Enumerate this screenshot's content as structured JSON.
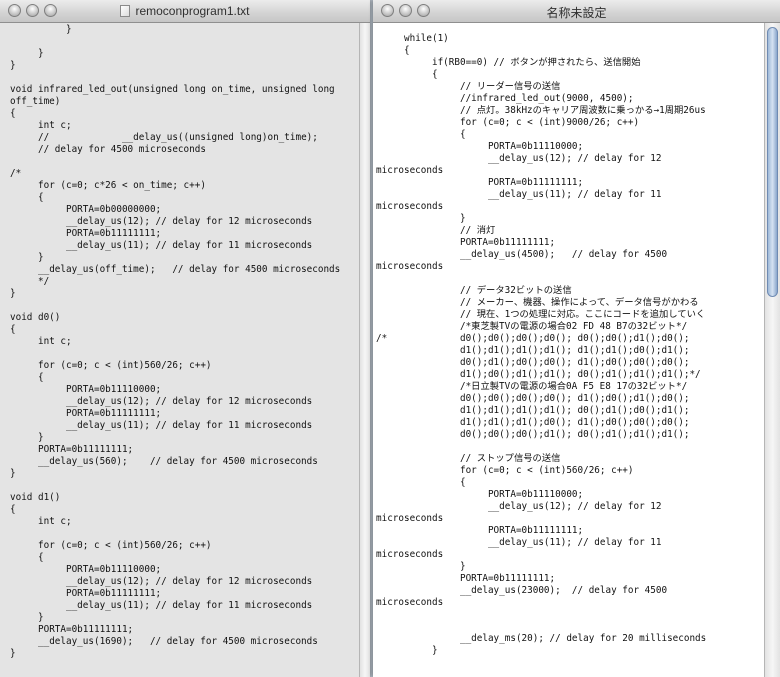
{
  "left_window": {
    "title": "remoconprogram1.txt",
    "code_lines": [
      "\t\t}",
      "",
      "\t}",
      "}",
      "",
      "void infrared_led_out(unsigned long on_time, unsigned long",
      "off_time)",
      "{",
      "\tint c;",
      "\t//\t\t\t__delay_us((unsigned long)on_time);",
      "\t// delay for 4500 microseconds",
      "",
      "/*",
      "\tfor (c=0; c*26 < on_time; c++)",
      "\t{",
      "\t\tPORTA=0b00000000;",
      "\t\t__delay_us(12); // delay for 12 microseconds",
      "\t\tPORTA=0b11111111;",
      "\t\t__delay_us(11); // delay for 11 microseconds",
      "\t}",
      "\t__delay_us(off_time);   // delay for 4500 microseconds",
      "\t*/",
      "}",
      "",
      "void d0()",
      "{",
      "\tint c;",
      "",
      "\tfor (c=0; c < (int)560/26; c++)",
      "\t{",
      "\t\tPORTA=0b11110000;",
      "\t\t__delay_us(12); // delay for 12 microseconds",
      "\t\tPORTA=0b11111111;",
      "\t\t__delay_us(11); // delay for 11 microseconds",
      "\t}",
      "\tPORTA=0b11111111;",
      "\t__delay_us(560);\t// delay for 4500 microseconds",
      "}",
      "",
      "void d1()",
      "{",
      "\tint c;",
      "",
      "\tfor (c=0; c < (int)560/26; c++)",
      "\t{",
      "\t\tPORTA=0b11110000;",
      "\t\t__delay_us(12); // delay for 12 microseconds",
      "\t\tPORTA=0b11111111;",
      "\t\t__delay_us(11); // delay for 11 microseconds",
      "\t}",
      "\tPORTA=0b11111111;",
      "\t__delay_us(1690);\t// delay for 4500 microseconds",
      "}"
    ]
  },
  "right_window": {
    "title": "名称未設定",
    "code_lines": [
      "\twhile(1)",
      "\t{",
      "\t\tif(RB0==0) // ボタンが押されたら、送信開始",
      "\t\t{",
      "\t\t\t// リーダー信号の送信",
      "\t\t\t//infrared_led_out(9000, 4500);",
      "\t\t\t// 点灯。38kHzのキャリア周波数に乗っかる→1周期26us",
      "\t\t\tfor (c=0; c < (int)9000/26; c++)",
      "\t\t\t{",
      "\t\t\t\tPORTA=0b11110000;",
      "\t\t\t\t__delay_us(12); // delay for 12",
      "microseconds",
      "\t\t\t\tPORTA=0b11111111;",
      "\t\t\t\t__delay_us(11); // delay for 11",
      "microseconds",
      "\t\t\t}",
      "\t\t\t// 消灯",
      "\t\t\tPORTA=0b11111111;",
      "\t\t\t__delay_us(4500);\t// delay for 4500",
      "microseconds",
      "",
      "\t\t\t// データ32ビットの送信",
      "\t\t\t// メーカー、機器、操作によって、データ信号がかわる",
      "\t\t\t// 現在、1つの処理に対応。ここにコードを追加していく",
      "\t\t\t/*東芝製TVの電源の場合02 FD 48 B7の32ビット*/",
      "/*\t\t\td0();d0();d0();d0(); d0();d0();d1();d0();",
      "\t\t\td1();d1();d1();d1(); d1();d1();d0();d1();",
      "\t\t\td0();d1();d0();d0(); d1();d0();d0();d0();",
      "\t\t\td1();d0();d1();d1(); d0();d1();d1();d1();*/",
      "\t\t\t/*日立製TVの電源の場合0A F5 E8 17の32ビット*/",
      "\t\t\td0();d0();d0();d0(); d1();d0();d1();d0();",
      "\t\t\td1();d1();d1();d1(); d0();d1();d0();d1();",
      "\t\t\td1();d1();d1();d0(); d1();d0();d0();d0();",
      "\t\t\td0();d0();d0();d1(); d0();d1();d1();d1();",
      "",
      "\t\t\t// ストップ信号の送信",
      "\t\t\tfor (c=0; c < (int)560/26; c++)",
      "\t\t\t{",
      "\t\t\t\tPORTA=0b11110000;",
      "\t\t\t\t__delay_us(12); // delay for 12",
      "microseconds",
      "\t\t\t\tPORTA=0b11111111;",
      "\t\t\t\t__delay_us(11); // delay for 11",
      "microseconds",
      "\t\t\t}",
      "\t\t\tPORTA=0b11111111;",
      "\t\t\t__delay_us(23000);\t// delay for 4500",
      "microseconds",
      "",
      "",
      "\t\t\t__delay_ms(20); // delay for 20 milliseconds",
      "\t\t}"
    ]
  }
}
